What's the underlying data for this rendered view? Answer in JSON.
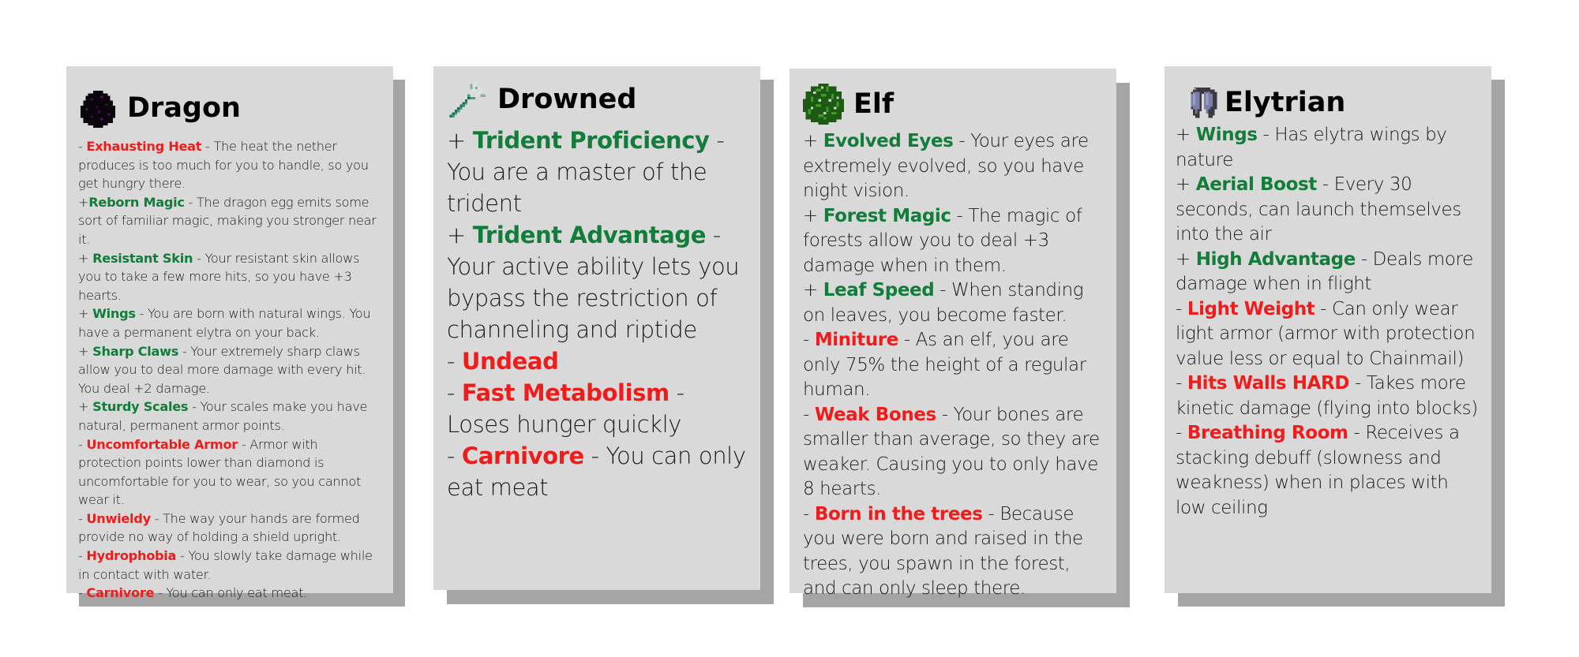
{
  "colors": {
    "card_bg": "#d9d9d9",
    "shadow": "#a5a5a5",
    "positive": "#127d3a",
    "negative": "#f01c1c"
  },
  "cards": [
    {
      "title": "Dragon",
      "icon": "dragon-egg-icon",
      "traits": [
        {
          "sign": "- ",
          "type": "neg",
          "name": "Exhausting Heat",
          "desc": " - The heat the nether produces is too much for you to handle, so you get hungry there."
        },
        {
          "sign": "+",
          "type": "pos",
          "name": "Reborn Magic",
          "desc": " - The dragon egg emits some sort of familiar magic, making you stronger near it."
        },
        {
          "sign": "+ ",
          "type": "pos",
          "name": "Resistant Skin",
          "desc": " - Your resistant skin allows you to take a few more hits, so you have +3 hearts."
        },
        {
          "sign": "+ ",
          "type": "pos",
          "name": "Wings",
          "desc": " - You are born with natural wings. You have a permanent elytra on your back."
        },
        {
          "sign": "+ ",
          "type": "pos",
          "name": "Sharp Claws",
          "desc": " - Your extremely sharp claws allow you to deal more damage with every hit. You deal +2 damage."
        },
        {
          "sign": "+ ",
          "type": "pos",
          "name": "Sturdy Scales",
          "desc": " - Your scales make you have natural, permanent armor points."
        },
        {
          "sign": "- ",
          "type": "neg",
          "name": "Uncomfortable Armor",
          "desc": " - Armor with protection points lower than diamond is uncomfortable for you to wear, so you cannot wear it."
        },
        {
          "sign": "- ",
          "type": "neg",
          "name": "Unwieldy",
          "desc": " - The way your hands are formed provide no way of holding a shield upright."
        },
        {
          "sign": "- ",
          "type": "neg",
          "name": "Hydrophobia",
          "desc": " - You slowly take damage while in contact with water."
        },
        {
          "sign": "- ",
          "type": "neg",
          "name": "Carnivore",
          "desc": " - You can only eat meat."
        }
      ]
    },
    {
      "title": "Drowned",
      "icon": "trident-icon",
      "traits": [
        {
          "sign": "+ ",
          "type": "pos",
          "name": "Trident Proficiency",
          "desc": " - You are a master of the trident"
        },
        {
          "sign": "+ ",
          "type": "pos",
          "name": "Trident Advantage",
          "desc": " - Your active ability lets you bypass the restriction of channeling and riptide"
        },
        {
          "sign": "- ",
          "type": "neg",
          "name": "Undead",
          "desc": ""
        },
        {
          "sign": "- ",
          "type": "neg",
          "name": "Fast Metabolism",
          "desc": " - Loses hunger quickly"
        },
        {
          "sign": "- ",
          "type": "neg",
          "name": "Carnivore",
          "desc": " - You can only eat meat"
        }
      ]
    },
    {
      "title": "Elf",
      "icon": "leaves-block-icon",
      "traits": [
        {
          "sign": "+ ",
          "type": "pos",
          "name": "Evolved Eyes",
          "desc": " - Your eyes are extremely evolved, so you have night vision."
        },
        {
          "sign": "+ ",
          "type": "pos",
          "name": "Forest Magic",
          "desc": " - The magic of forests allow you to deal +3 damage when in them."
        },
        {
          "sign": "+ ",
          "type": "pos",
          "name": "Leaf Speed",
          "desc": " - When standing on leaves, you become faster."
        },
        {
          "sign": "- ",
          "type": "neg",
          "name": "Miniture",
          "desc": " - As an elf, you are only 75% the height of a regular human."
        },
        {
          "sign": "- ",
          "type": "neg",
          "name": "Weak Bones",
          "desc": " - Your bones are smaller than average, so they are weaker. Causing you to only have 8 hearts."
        },
        {
          "sign": "- ",
          "type": "neg",
          "name": "Born in the trees",
          "desc": " - Because you were born and raised in the trees, you spawn in the forest, and can only sleep there."
        }
      ]
    },
    {
      "title": "Elytrian",
      "icon": "elytra-icon",
      "traits": [
        {
          "sign": "+ ",
          "type": "pos",
          "name": "Wings",
          "desc": " - Has elytra wings by nature"
        },
        {
          "sign": "+ ",
          "type": "pos",
          "name": "Aerial Boost",
          "desc": " - Every 30 seconds, can launch themselves into the air"
        },
        {
          "sign": "+ ",
          "type": "pos",
          "name": "High Advantage",
          "desc": " - Deals more damage when in flight"
        },
        {
          "sign": "- ",
          "type": "neg",
          "name": "Light Weight",
          "desc": " - Can only wear light armor (armor with protection value less or equal to Chainmail)"
        },
        {
          "sign": "- ",
          "type": "neg",
          "name": "Hits Walls HARD",
          "desc": " - Takes more kinetic damage (flying into blocks)"
        },
        {
          "sign": "- ",
          "type": "neg",
          "name": "Breathing Room",
          "desc": " - Receives a stacking debuff (slowness and weakness) when in places with low ceiling"
        }
      ]
    }
  ]
}
